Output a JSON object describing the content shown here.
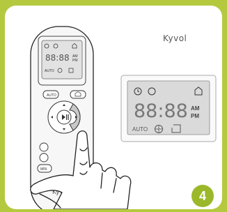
{
  "brand": {
    "name": "Kyvol"
  },
  "remote": {
    "display_time": "88:88",
    "am": "AM",
    "pm": "PM",
    "auto": "AUTO",
    "button_auto": "AUTO",
    "button_min": "MIN",
    "logo": "Kyvol"
  },
  "display_zoom": {
    "time": "88:88",
    "am": "AM",
    "pm": "PM",
    "auto": "AUTO"
  },
  "step": {
    "number": "4"
  },
  "colors": {
    "accent": "#9bb82a",
    "frame": "#b5c93f",
    "lcd": "#d8d8d8"
  }
}
